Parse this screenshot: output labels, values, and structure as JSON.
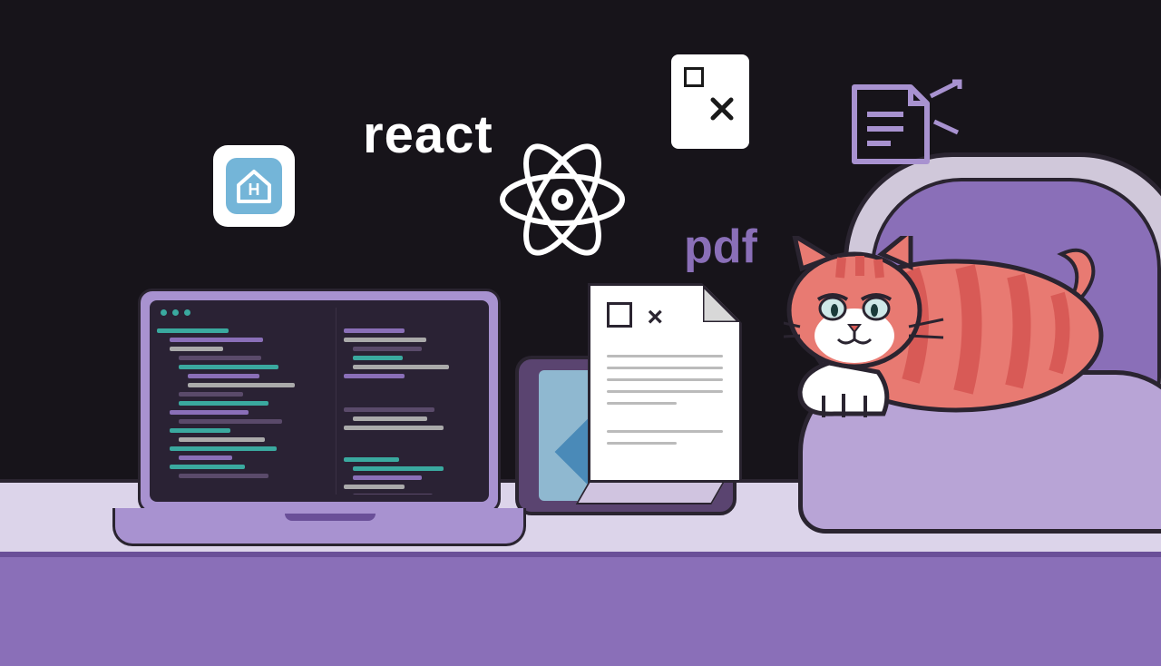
{
  "labels": {
    "react": "react",
    "pdf": "pdf",
    "home_letter": "H"
  },
  "icons": {
    "home_badge": "home-badge-icon",
    "react_atom": "react-atom-icon",
    "small_file_x": "file-x-icon",
    "purple_file": "file-lines-icon"
  },
  "scene": {
    "devices": [
      "laptop",
      "tablet"
    ],
    "document_mark": "×",
    "animal": "cat"
  },
  "colors": {
    "background": "#17141a",
    "purple": "#8a6fb8",
    "lilac": "#a892d0",
    "desk_top": "#dcd4ea",
    "home_blue": "#74b5d8",
    "tablet_blue": "#8fb8d0",
    "cat_body": "#e87a72",
    "cat_stripes": "#d85a56"
  }
}
